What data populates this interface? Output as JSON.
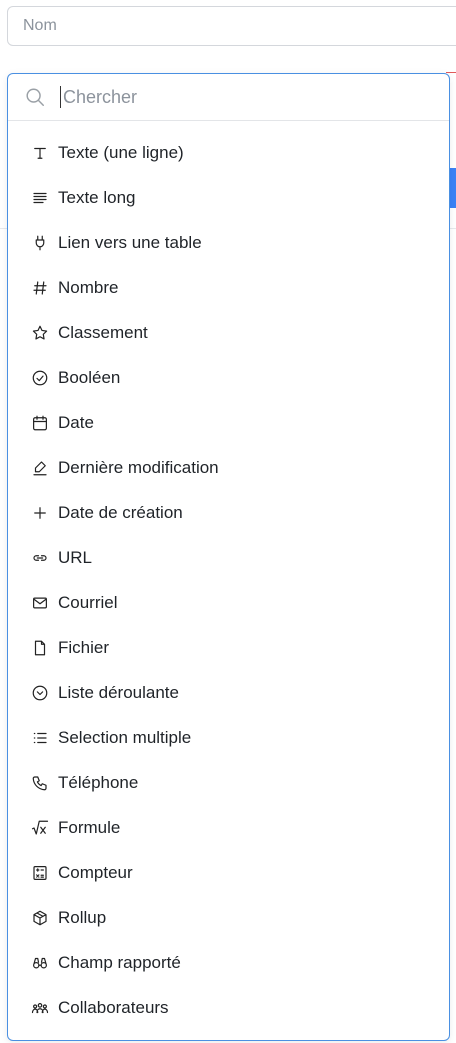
{
  "form": {
    "name_placeholder": "Nom",
    "name_value": ""
  },
  "search": {
    "placeholder": "Chercher",
    "value": ""
  },
  "field_types": [
    {
      "label": "Texte (une ligne)",
      "icon": "text-icon"
    },
    {
      "label": "Texte long",
      "icon": "long-text-icon"
    },
    {
      "label": "Lien vers une table",
      "icon": "plug-icon"
    },
    {
      "label": "Nombre",
      "icon": "hash-icon"
    },
    {
      "label": "Classement",
      "icon": "star-icon"
    },
    {
      "label": "Booléen",
      "icon": "check-circle-icon"
    },
    {
      "label": "Date",
      "icon": "calendar-icon"
    },
    {
      "label": "Dernière modification",
      "icon": "eraser-icon"
    },
    {
      "label": "Date de création",
      "icon": "plus-icon"
    },
    {
      "label": "URL",
      "icon": "link-icon"
    },
    {
      "label": "Courriel",
      "icon": "mail-icon"
    },
    {
      "label": "Fichier",
      "icon": "file-icon"
    },
    {
      "label": "Liste déroulante",
      "icon": "chevron-circle-icon"
    },
    {
      "label": "Selection multiple",
      "icon": "list-icon"
    },
    {
      "label": "Téléphone",
      "icon": "phone-icon"
    },
    {
      "label": "Formule",
      "icon": "sqrt-x-icon"
    },
    {
      "label": "Compteur",
      "icon": "calculator-icon"
    },
    {
      "label": "Rollup",
      "icon": "box-icon"
    },
    {
      "label": "Champ rapporté",
      "icon": "binoculars-icon"
    },
    {
      "label": "Collaborateurs",
      "icon": "users-icon"
    }
  ],
  "colors": {
    "focus_border": "#4a90e2",
    "text": "#1f2328",
    "placeholder": "#8c939c"
  }
}
